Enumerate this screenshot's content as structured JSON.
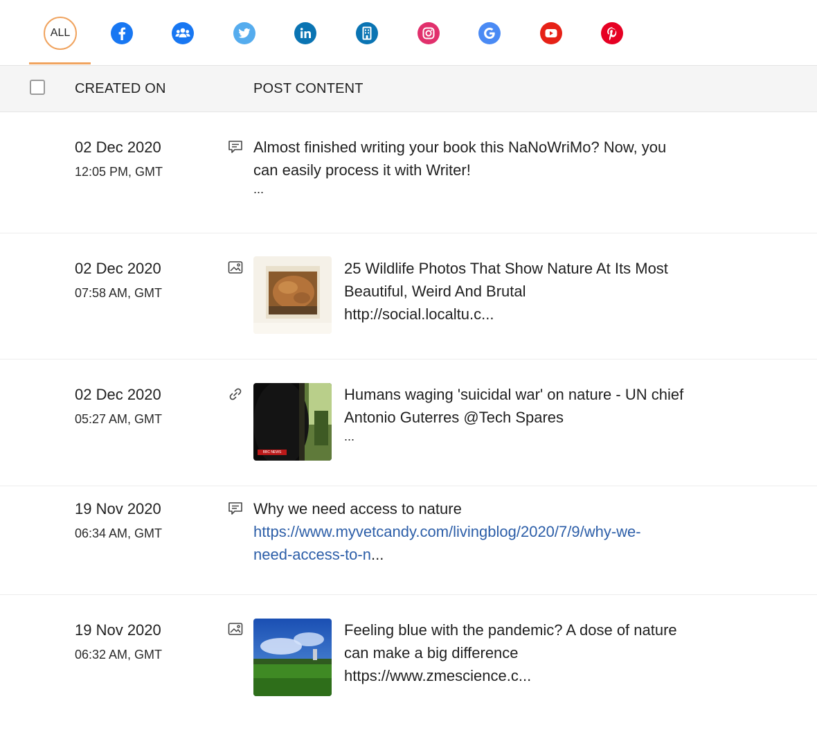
{
  "channel_tabs": {
    "all_label": "ALL",
    "items": [
      {
        "icon": "facebook-icon",
        "color": "#1877f2"
      },
      {
        "icon": "facebook-groups-icon",
        "color": "#1877f2"
      },
      {
        "icon": "twitter-icon",
        "color": "#55acee"
      },
      {
        "icon": "linkedin-icon",
        "color": "#0a74b3"
      },
      {
        "icon": "linkedin-company-page-icon",
        "color": "#0a74b3"
      },
      {
        "icon": "instagram-icon",
        "color": "#e1306c"
      },
      {
        "icon": "google-business-icon",
        "color": "#4a8af4"
      },
      {
        "icon": "youtube-icon",
        "color": "#e62117"
      },
      {
        "icon": "pinterest-icon",
        "color": "#e60023"
      }
    ],
    "active_color": "#f0a35e"
  },
  "table": {
    "columns": {
      "created_on": "CREATED ON",
      "post_content": "POST CONTENT"
    },
    "rows": [
      {
        "date": "02 Dec 2020",
        "time": "12:05 PM, GMT",
        "type": "text-post-icon",
        "lines": [
          "Almost finished writing your book this NaNoWriMo? Now, you",
          "can easily process it with Writer!"
        ],
        "ellipsis": "..."
      },
      {
        "date": "02 Dec 2020",
        "time": "07:58 AM, GMT",
        "type": "image-post-icon",
        "lines": [
          "25 Wildlife Photos That Show Nature At Its Most",
          "Beautiful, Weird And Brutal",
          "http://social.localtu.c..."
        ]
      },
      {
        "date": "02 Dec 2020",
        "time": "05:27 AM, GMT",
        "type": "link-post-icon",
        "lines": [
          "Humans waging 'suicidal war' on nature - UN chief",
          "Antonio Guterres @Tech Spares"
        ],
        "ellipsis": "...",
        "thumb_badge": "BBC NEWS"
      },
      {
        "date": "19 Nov 2020",
        "time": "06:34 AM, GMT",
        "type": "text-post-icon",
        "lines": [
          "Why we need access to nature"
        ],
        "link_lines": [
          "https://www.myvetcandy.com/livingblog/2020/7/9/why-we-",
          "need-access-to-n"
        ],
        "link_suffix": "..."
      },
      {
        "date": "19 Nov 2020",
        "time": "06:32 AM, GMT",
        "type": "image-post-icon",
        "lines": [
          "Feeling blue with the pandemic? A dose of nature",
          "can make a big difference",
          "https://www.zmescience.c..."
        ]
      }
    ]
  }
}
